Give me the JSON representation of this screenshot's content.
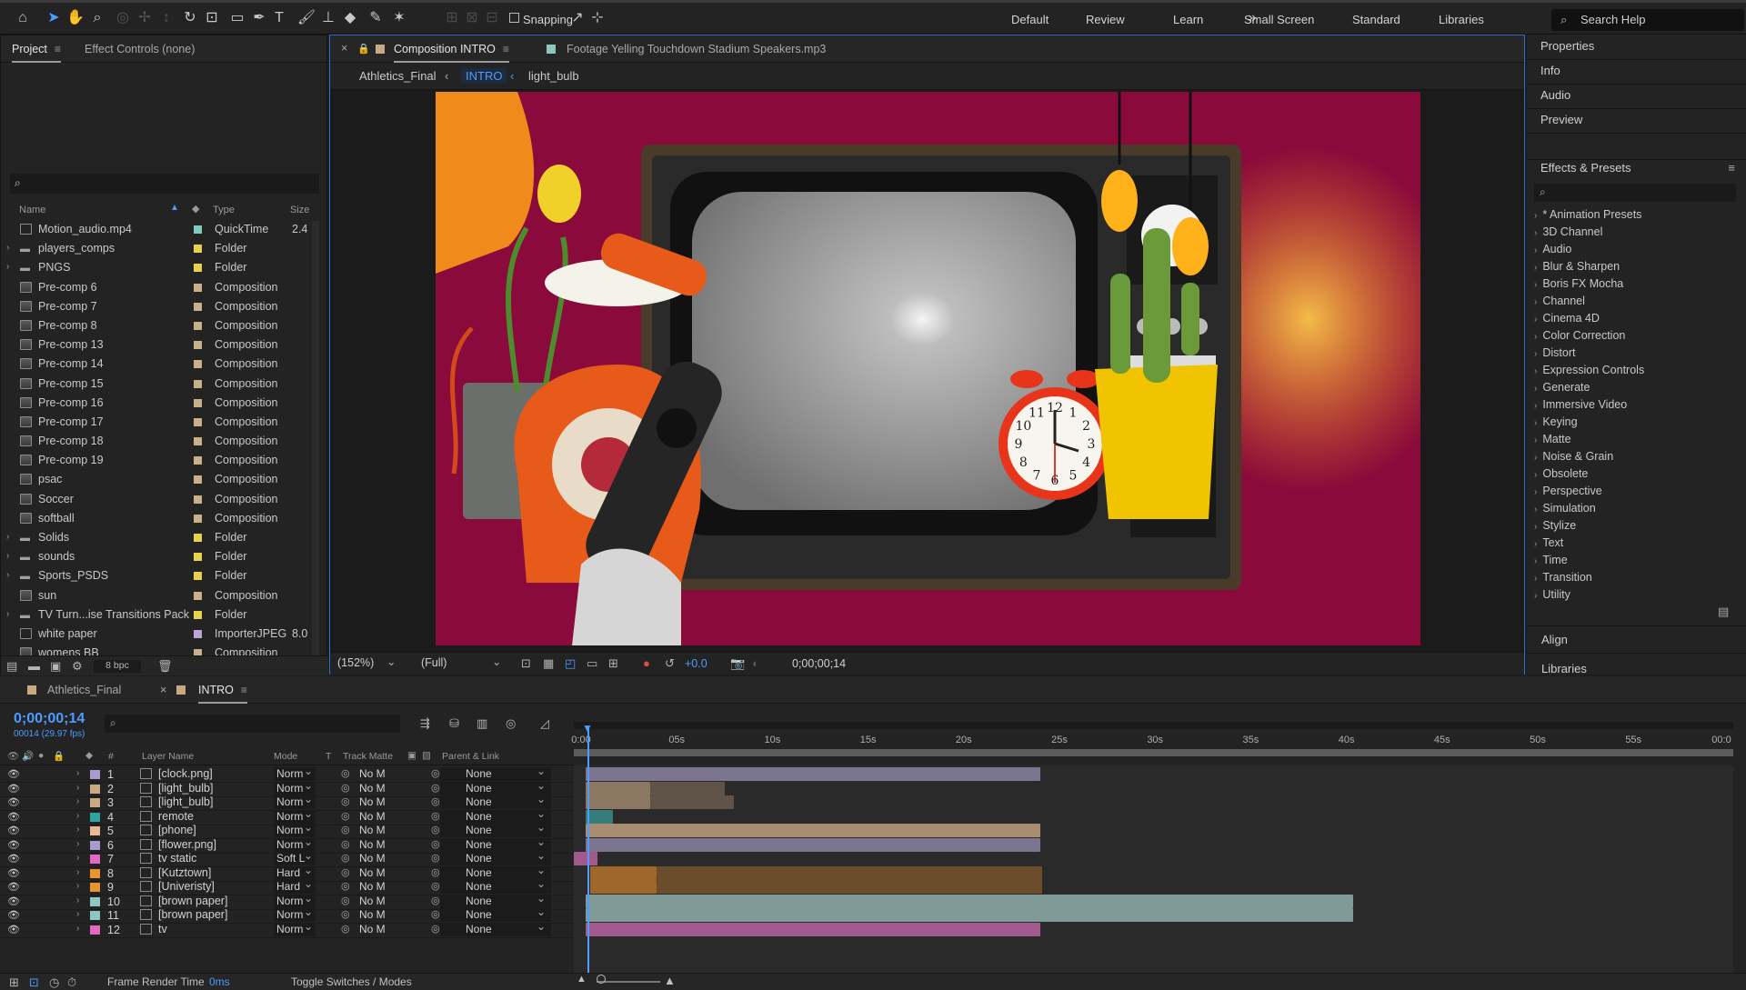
{
  "toolbar": {
    "snapping": "Snapping",
    "workspaces": [
      "Default",
      "Review",
      "Learn",
      "Small Screen",
      "Standard",
      "Libraries"
    ],
    "search_help": "Search Help"
  },
  "project": {
    "tabs": {
      "project": "Project",
      "effect_controls": "Effect Controls (none)"
    },
    "columns": {
      "name": "Name",
      "type": "Type",
      "size": "Size"
    },
    "items": [
      {
        "name": "Motion_audio.mp4",
        "type": "QuickTime",
        "size": "2.4",
        "color": "#7fc9c0",
        "kind": "file",
        "twirl": false
      },
      {
        "name": "players_comps",
        "type": "Folder",
        "size": "",
        "color": "#e8d24a",
        "kind": "folder",
        "twirl": true
      },
      {
        "name": "PNGS",
        "type": "Folder",
        "size": "",
        "color": "#e8d24a",
        "kind": "folder",
        "twirl": true
      },
      {
        "name": "Pre-comp 6",
        "type": "Composition",
        "size": "",
        "color": "#c9b08a",
        "kind": "comp",
        "twirl": false
      },
      {
        "name": "Pre-comp 7",
        "type": "Composition",
        "size": "",
        "color": "#c9b08a",
        "kind": "comp",
        "twirl": false
      },
      {
        "name": "Pre-comp 8",
        "type": "Composition",
        "size": "",
        "color": "#c9b08a",
        "kind": "comp",
        "twirl": false
      },
      {
        "name": "Pre-comp 13",
        "type": "Composition",
        "size": "",
        "color": "#c9b08a",
        "kind": "comp",
        "twirl": false
      },
      {
        "name": "Pre-comp 14",
        "type": "Composition",
        "size": "",
        "color": "#c9b08a",
        "kind": "comp",
        "twirl": false
      },
      {
        "name": "Pre-comp 15",
        "type": "Composition",
        "size": "",
        "color": "#c9b08a",
        "kind": "comp",
        "twirl": false
      },
      {
        "name": "Pre-comp 16",
        "type": "Composition",
        "size": "",
        "color": "#c9b08a",
        "kind": "comp",
        "twirl": false
      },
      {
        "name": "Pre-comp 17",
        "type": "Composition",
        "size": "",
        "color": "#c9b08a",
        "kind": "comp",
        "twirl": false
      },
      {
        "name": "Pre-comp 18",
        "type": "Composition",
        "size": "",
        "color": "#c9b08a",
        "kind": "comp",
        "twirl": false
      },
      {
        "name": "Pre-comp 19",
        "type": "Composition",
        "size": "",
        "color": "#c9b08a",
        "kind": "comp",
        "twirl": false
      },
      {
        "name": "psac",
        "type": "Composition",
        "size": "",
        "color": "#c9b08a",
        "kind": "comp",
        "twirl": false
      },
      {
        "name": "Soccer",
        "type": "Composition",
        "size": "",
        "color": "#c9b08a",
        "kind": "comp",
        "twirl": false
      },
      {
        "name": "softball",
        "type": "Composition",
        "size": "",
        "color": "#c9b08a",
        "kind": "comp",
        "twirl": false
      },
      {
        "name": "Solids",
        "type": "Folder",
        "size": "",
        "color": "#e8d24a",
        "kind": "folder",
        "twirl": true
      },
      {
        "name": "sounds",
        "type": "Folder",
        "size": "",
        "color": "#e8d24a",
        "kind": "folder",
        "twirl": true
      },
      {
        "name": "Sports_PSDS",
        "type": "Folder",
        "size": "",
        "color": "#e8d24a",
        "kind": "folder",
        "twirl": true
      },
      {
        "name": "sun",
        "type": "Composition",
        "size": "",
        "color": "#c9b08a",
        "kind": "comp",
        "twirl": false
      },
      {
        "name": "TV Turn...ise Transitions Pack",
        "type": "Folder",
        "size": "",
        "color": "#e8d24a",
        "kind": "folder",
        "twirl": true
      },
      {
        "name": "white paper",
        "type": "ImporterJPEG",
        "size": "8.0",
        "color": "#b9a6d6",
        "kind": "file",
        "twirl": false
      },
      {
        "name": "womens BB",
        "type": "Composition",
        "size": "",
        "color": "#c9b08a",
        "kind": "comp",
        "twirl": false
      }
    ],
    "bpc": "8 bpc"
  },
  "comp": {
    "tab_label": "Composition INTRO",
    "footage_tab": "Footage Yelling Touchdown Stadium Speakers.mp3",
    "breadcrumbs": [
      "Athletics_Final",
      "INTRO",
      "light_bulb"
    ],
    "zoom": "(152%)",
    "resolution": "(Full)",
    "exposure": "+0.0",
    "timecode": "0;00;00;14",
    "clock_numbers": [
      "12",
      "1",
      "2",
      "3",
      "4",
      "5",
      "6",
      "7",
      "8",
      "9",
      "10",
      "11"
    ]
  },
  "right_panels": {
    "top": [
      "Properties",
      "Info",
      "Audio",
      "Preview"
    ],
    "effects_title": "Effects & Presets",
    "effects": [
      "* Animation Presets",
      "3D Channel",
      "Audio",
      "Blur & Sharpen",
      "Boris FX Mocha",
      "Channel",
      "Cinema 4D",
      "Color Correction",
      "Distort",
      "Expression Controls",
      "Generate",
      "Immersive Video",
      "Keying",
      "Matte",
      "Noise & Grain",
      "Obsolete",
      "Perspective",
      "Simulation",
      "Stylize",
      "Text",
      "Time",
      "Transition",
      "Utility"
    ],
    "bottom": [
      "Align",
      "Libraries"
    ]
  },
  "timeline": {
    "tabs": [
      "Athletics_Final",
      "INTRO"
    ],
    "timecode": "0;00;00;14",
    "timecode_sub": "00014 (29.97 fps)",
    "columns": {
      "num": "#",
      "layer_name": "Layer Name",
      "mode": "Mode",
      "t": "T",
      "track_matte": "Track Matte",
      "parent": "Parent & Link"
    },
    "ticks": [
      "0:00",
      "05s",
      "10s",
      "15s",
      "20s",
      "25s",
      "30s",
      "35s",
      "40s",
      "45s",
      "50s",
      "55s",
      "00:0"
    ],
    "layers": [
      {
        "num": "1",
        "name": "[clock.png]",
        "mode": "Norm",
        "matte": "No M",
        "parent": "None",
        "color": "#a79bd0",
        "start": 0.01,
        "end": 0.402,
        "bar": "#7b7590"
      },
      {
        "num": "2",
        "name": "[light_bulb]",
        "mode": "Norm",
        "matte": "No M",
        "parent": "None",
        "color": "#c9a983",
        "start": 0.01,
        "end": 0.066,
        "bar": "#8c7762",
        "tail": 0.13
      },
      {
        "num": "3",
        "name": "[light_bulb]",
        "mode": "Norm",
        "matte": "No M",
        "parent": "None",
        "color": "#c9a983",
        "start": 0.01,
        "end": 0.066,
        "bar": "#8c7762",
        "tail": 0.138
      },
      {
        "num": "4",
        "name": "remote",
        "mode": "Norm",
        "matte": "No M",
        "parent": "None",
        "color": "#2fa3a0",
        "start": 0.01,
        "end": 0.034,
        "bar": "#357c7c"
      },
      {
        "num": "5",
        "name": "[phone]",
        "mode": "Norm",
        "matte": "No M",
        "parent": "None",
        "color": "#e8b994",
        "start": 0.01,
        "end": 0.402,
        "bar": "#a98d72"
      },
      {
        "num": "6",
        "name": "[flower.png]",
        "mode": "Norm",
        "matte": "No M",
        "parent": "None",
        "color": "#a79bd0",
        "start": 0.01,
        "end": 0.402,
        "bar": "#7b7590"
      },
      {
        "num": "7",
        "name": "tv static",
        "mode": "Soft L",
        "matte": "No M",
        "parent": "None",
        "color": "#e06ac0",
        "start": 0.0,
        "end": 0.02,
        "bar": "#a05a8e"
      },
      {
        "num": "8",
        "name": "[Kutztown]",
        "mode": "Hard",
        "matte": "No M",
        "parent": "None",
        "color": "#e8952e",
        "start": 0.014,
        "end": 0.071,
        "bar": "#a0672c",
        "tail": 0.404
      },
      {
        "num": "9",
        "name": "[Univeristy]",
        "mode": "Hard",
        "matte": "No M",
        "parent": "None",
        "color": "#e8952e",
        "start": 0.014,
        "end": 0.071,
        "bar": "#a0672c",
        "tail": 0.404
      },
      {
        "num": "10",
        "name": "[brown paper]",
        "mode": "Norm",
        "matte": "No M",
        "parent": "None",
        "color": "#8fc6c0",
        "start": 0.01,
        "end": 0.672,
        "bar": "#7f9a97"
      },
      {
        "num": "11",
        "name": "[brown paper]",
        "mode": "Norm",
        "matte": "No M",
        "parent": "None",
        "color": "#8fc6c0",
        "start": 0.01,
        "end": 0.672,
        "bar": "#7f9a97"
      },
      {
        "num": "12",
        "name": "tv",
        "mode": "Norm",
        "matte": "No M",
        "parent": "None",
        "color": "#e06ac0",
        "start": 0.01,
        "end": 0.402,
        "bar": "#a05a8e"
      }
    ],
    "frame_render": "Frame Render Time",
    "frame_render_value": "0ms",
    "toggle": "Toggle Switches / Modes"
  },
  "colors": {
    "accent": "#4d9cff",
    "canvas_bg": "#8a0b3b"
  }
}
